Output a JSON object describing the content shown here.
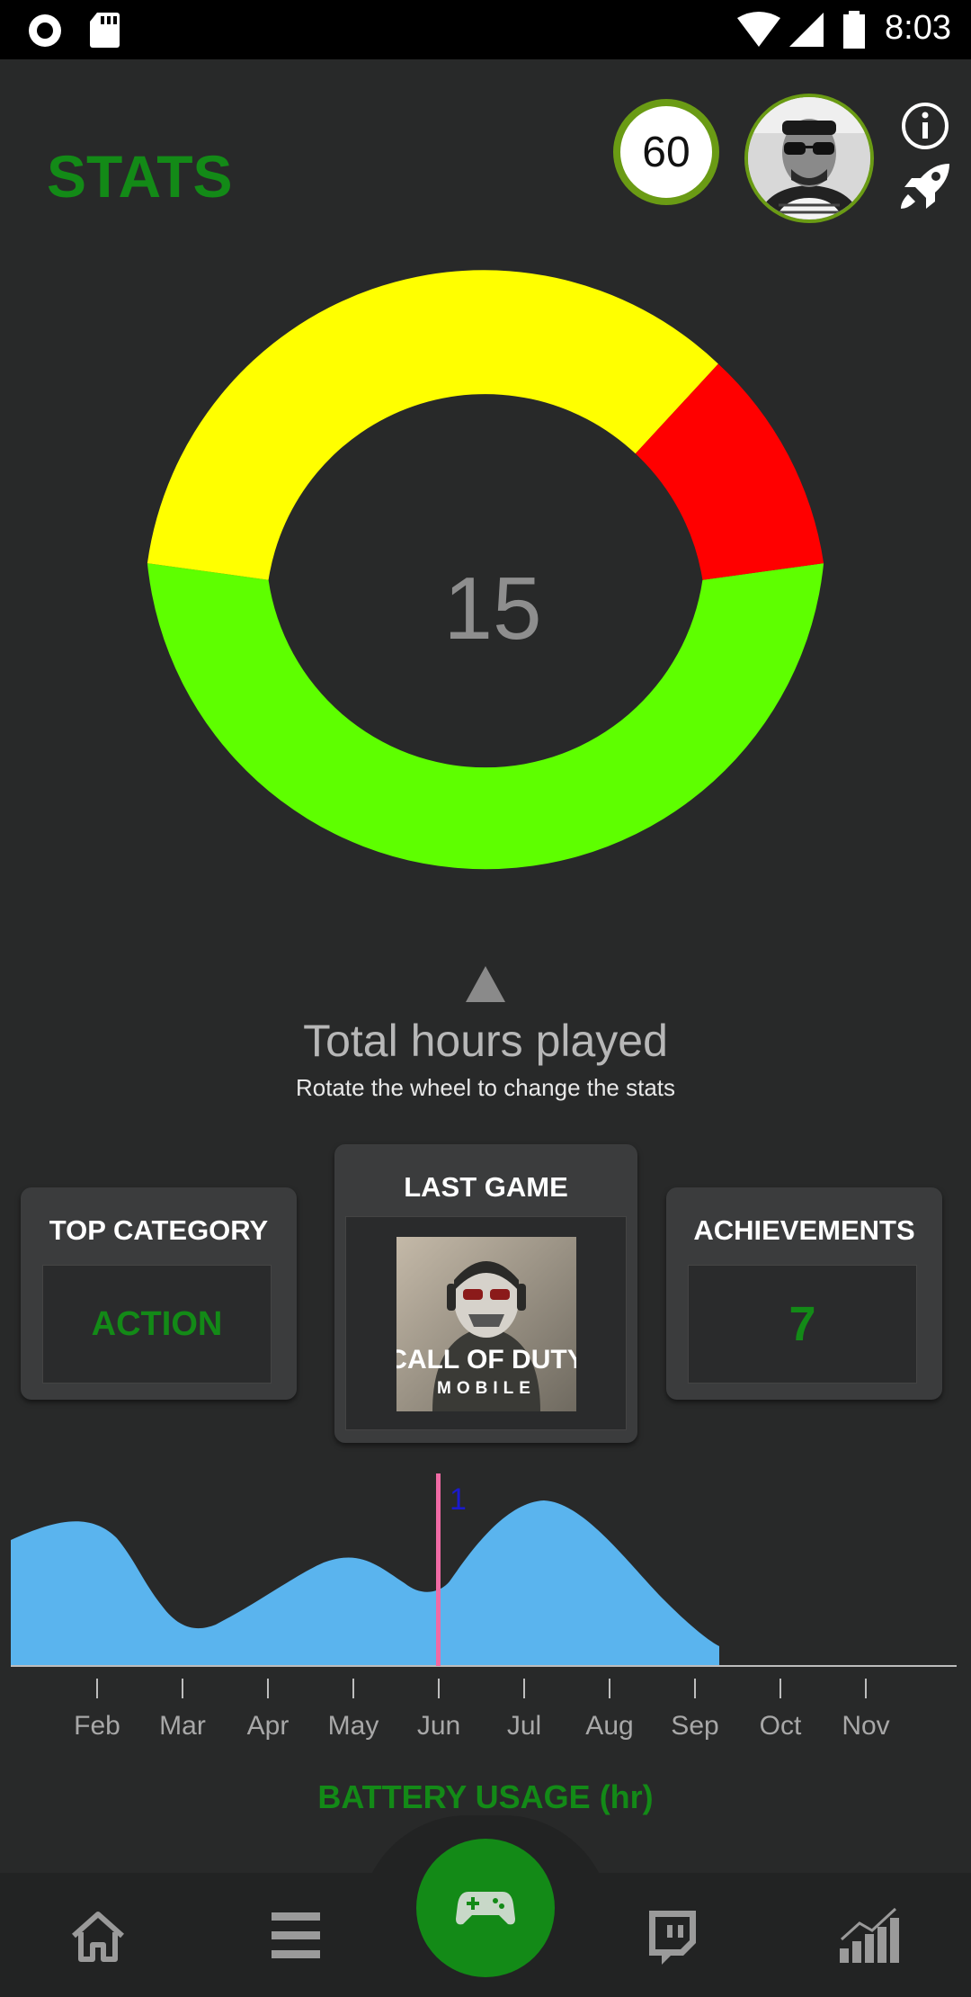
{
  "status_bar": {
    "time": "8:03",
    "icons": [
      "record-icon",
      "sd-card-icon",
      "wifi-icon",
      "signal-icon",
      "battery-icon"
    ]
  },
  "header": {
    "title": "STATS",
    "level": "60",
    "icons": [
      "avatar",
      "info-icon",
      "rocket-icon"
    ]
  },
  "wheel": {
    "center_value": "15",
    "title": "Total hours played",
    "subtitle": "Rotate the wheel to change the stats",
    "segments_colors": [
      "#5eff00",
      "#ffff00",
      "#ff0000"
    ]
  },
  "cards": {
    "top_category": {
      "label": "TOP CATEGORY",
      "value": "ACTION"
    },
    "last_game": {
      "label": "LAST GAME",
      "game_title_line1": "CALL OF DUTY",
      "game_title_line2": "MOBILE"
    },
    "achievements": {
      "label": "ACHIEVEMENTS",
      "value": "7"
    }
  },
  "chart_data": {
    "type": "area",
    "categories": [
      "Feb",
      "Mar",
      "Apr",
      "May",
      "Jun",
      "Jul",
      "Aug",
      "Sep",
      "Oct",
      "Nov"
    ],
    "marker_category": "Jun",
    "marker_label": "1",
    "title": "BATTERY USAGE (hr)"
  },
  "colors": {
    "accent": "#138a17",
    "background": "#282929",
    "area": "#5ab4ee",
    "marker": "#f06aa4"
  },
  "nav": {
    "items": [
      "home-icon",
      "menu-icon",
      "gamepad-icon",
      "twitch-icon",
      "chart-icon"
    ]
  }
}
